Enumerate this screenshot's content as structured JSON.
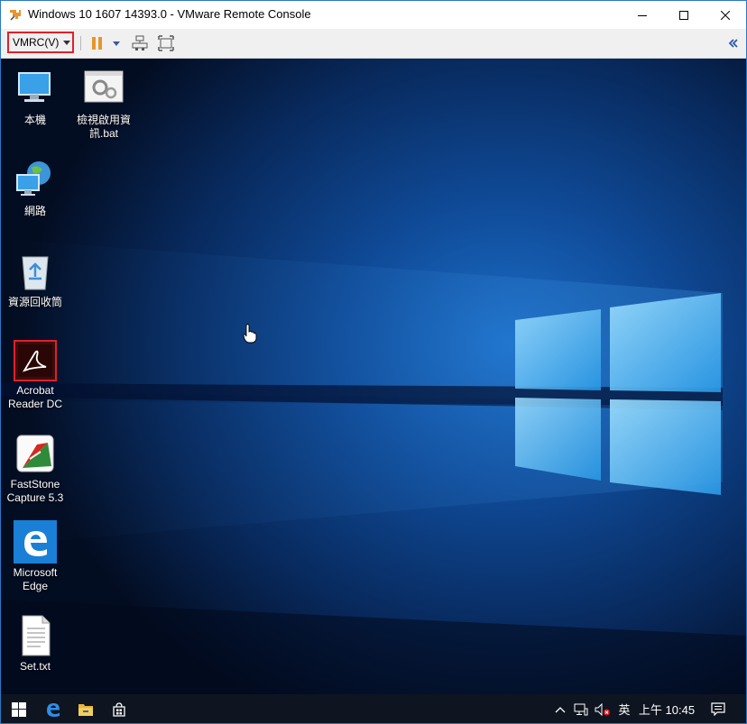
{
  "window": {
    "title": "Windows 10 1607 14393.0 - VMware Remote Console",
    "controls": [
      "minimize-icon",
      "maximize-icon",
      "close-icon"
    ]
  },
  "toolbar": {
    "vmrc_menu_label": "VMRC(V)",
    "icons": [
      "pause-icon",
      "dropdown-icon",
      "send-ctrl-alt-del-icon",
      "fullscreen-icon",
      "collapse-double-chevron-icon"
    ],
    "accent_color": "#e0202a",
    "pause_color": "#e8952a"
  },
  "desktop": {
    "icons": [
      {
        "label": "本機",
        "icon": "this-pc-icon"
      },
      {
        "label": "檢視啟用資訊.bat",
        "icon": "bat-file-icon"
      },
      {
        "label": "網路",
        "icon": "network-icon"
      },
      {
        "label": "資源回收筒",
        "icon": "recycle-bin-icon"
      },
      {
        "label": "Acrobat Reader DC",
        "icon": "acrobat-reader-icon"
      },
      {
        "label": "FastStone Capture 5.3",
        "icon": "faststone-capture-icon"
      },
      {
        "label": "Microsoft Edge",
        "icon": "edge-icon"
      },
      {
        "label": "Set.txt",
        "icon": "txt-file-icon"
      }
    ],
    "highlight_color": "#e0202a"
  },
  "taskbar": {
    "items": [
      "start-icon",
      "edge-taskbar-icon",
      "file-explorer-icon",
      "store-icon"
    ],
    "tray": {
      "icons": [
        "chevron-up-icon",
        "network-tray-icon",
        "volume-muted-icon"
      ],
      "ime": "英",
      "clock": "上午 10:45"
    }
  }
}
